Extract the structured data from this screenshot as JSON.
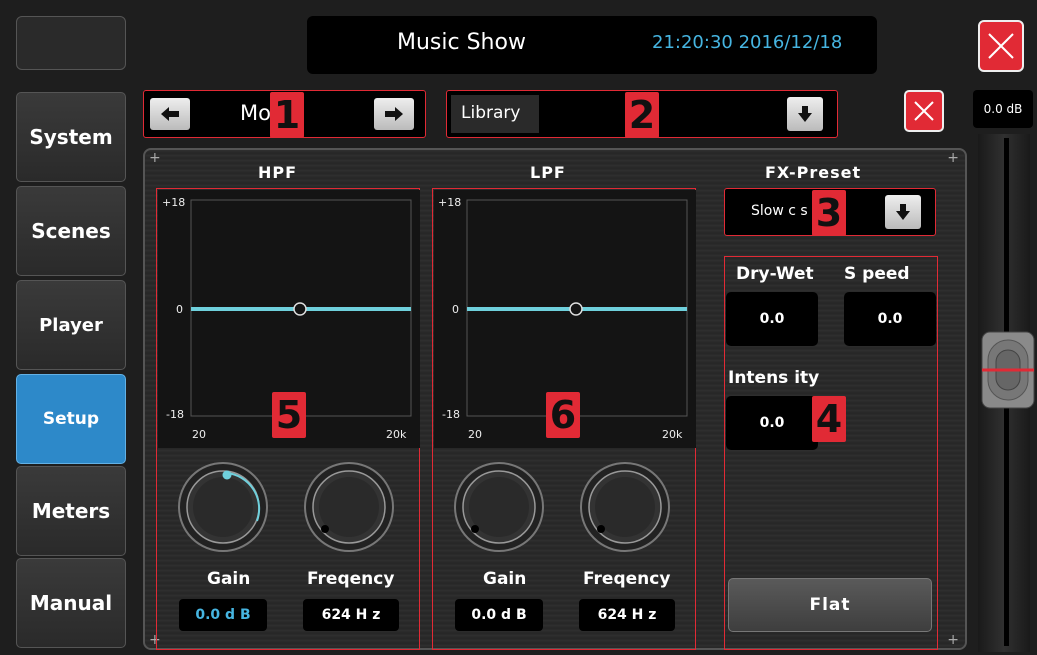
{
  "header": {
    "title": "Music Show",
    "datetime": "21:20:30  2016/12/18"
  },
  "sidebar": {
    "items": [
      {
        "label": "System"
      },
      {
        "label": "Scenes"
      },
      {
        "label": "Player"
      },
      {
        "label": "Setup",
        "active": true
      },
      {
        "label": "Meters"
      },
      {
        "label": "Manual"
      }
    ]
  },
  "model": {
    "name": "Mo  l 1"
  },
  "library": {
    "label": "Library"
  },
  "badges": [
    "1",
    "2",
    "3",
    "4",
    "5",
    "6"
  ],
  "hpf": {
    "title": "HPF",
    "y_top": "+18",
    "y_mid": "0",
    "y_bot": "-18",
    "x_left": "20",
    "x_right": "20k",
    "gain_label": "Gain",
    "freq_label": "Freqency",
    "gain_value": "0.0 d B",
    "freq_value": "624 H z"
  },
  "lpf": {
    "title": "LPF",
    "y_top": "+18",
    "y_mid": "0",
    "y_bot": "-18",
    "x_left": "20",
    "x_right": "20k",
    "gain_label": "Gain",
    "freq_label": "Freqency",
    "gain_value": "0.0 d B",
    "freq_value": "624 H z"
  },
  "fx": {
    "title": "FX-Preset",
    "preset": "Slow c      s",
    "dry_wet_label": "Dry-Wet",
    "dry_wet_value": "0.0",
    "speed_label": "S peed",
    "speed_value": "0.0",
    "intensity_label": "Intens ity",
    "intensity_value": "0.0",
    "flat_label": "Flat"
  },
  "fader": {
    "db": "0.0 dB"
  },
  "colors": {
    "accent_red": "#e12a35",
    "accent_blue": "#2d89c9",
    "curve": "#6fd0dc",
    "time": "#46b5e1"
  }
}
